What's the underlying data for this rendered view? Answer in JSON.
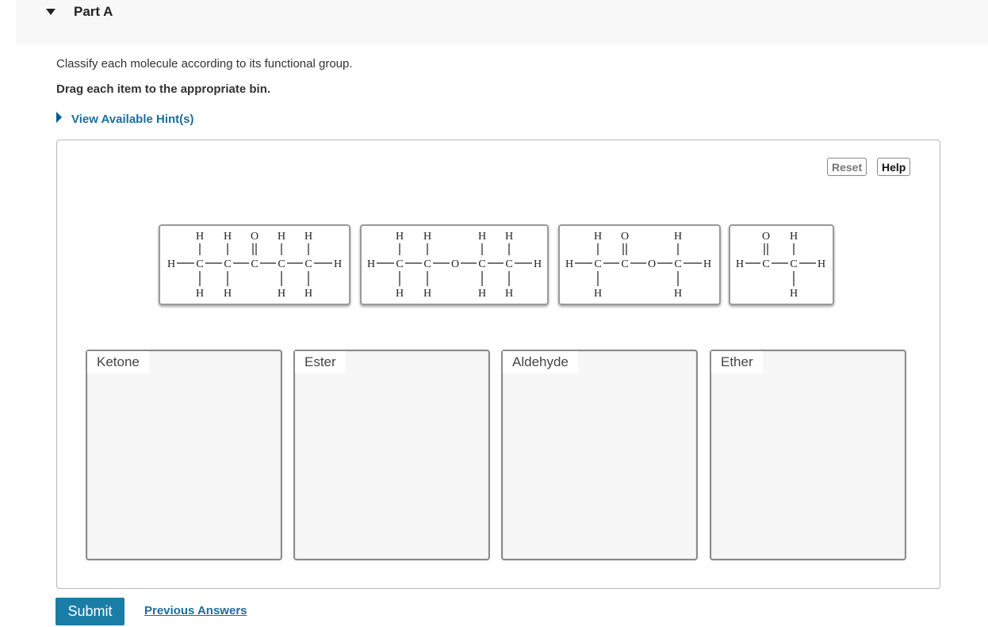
{
  "part": {
    "title": "Part A"
  },
  "instructions": {
    "line1": "Classify each molecule according to its functional group.",
    "line2": "Drag each item to the appropriate bin."
  },
  "hint_link": "View Available Hint(s)",
  "controls": {
    "reset": "Reset",
    "help": "Help"
  },
  "bins": [
    {
      "label": "Ketone"
    },
    {
      "label": "Ester"
    },
    {
      "label": "Aldehyde"
    },
    {
      "label": "Ether"
    }
  ],
  "molecules": [
    {
      "atoms": [
        "H",
        "C",
        "O"
      ]
    },
    {
      "atoms": [
        "H",
        "C",
        "O"
      ]
    },
    {
      "atoms": [
        "H",
        "C",
        "O"
      ]
    },
    {
      "atoms": [
        "H",
        "C",
        "O"
      ]
    }
  ],
  "footer": {
    "submit": "Submit",
    "previous_answers": "Previous Answers"
  },
  "colors": {
    "accent": "#1a7da6",
    "link": "#1a6f9c"
  }
}
